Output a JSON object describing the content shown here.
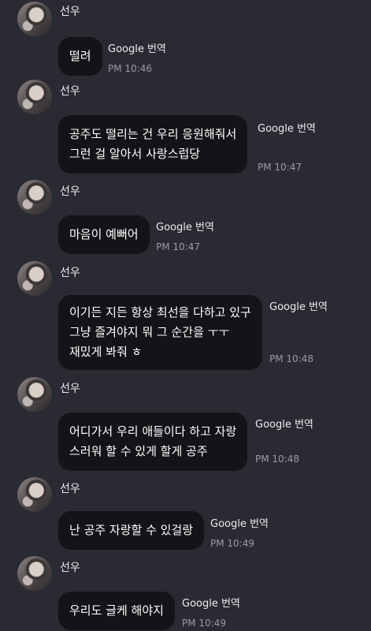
{
  "theme": {
    "background": "#2a2a33",
    "bubble": "#141418",
    "time_color": "#9b9ba4"
  },
  "messages": [
    {
      "sender": "선우",
      "text": [
        "떨려"
      ],
      "translate_label": "Google 번역",
      "time": "PM 10:46"
    },
    {
      "sender": "선우",
      "text": [
        "공주도 떨리는 건 우리 응원해줘서",
        "그런 걸 알아서 사랑스럽당"
      ],
      "translate_label": "Google 번역",
      "time": "PM 10:47"
    },
    {
      "sender": "선우",
      "text": [
        "마음이 예뻐어"
      ],
      "translate_label": "Google 번역",
      "time": "PM 10:47"
    },
    {
      "sender": "선우",
      "text": [
        "이기든 지든 항상 최선을 다하고 있구",
        " 그냥 즐겨야지 뭐 그 순간을 ㅜㅜ",
        "재밌게 봐줘 ㅎ"
      ],
      "translate_label": "Google 번역",
      "time": "PM 10:48"
    },
    {
      "sender": "선우",
      "text": [
        "어디가서 우리 애들이다 하고 자랑",
        "스러워 할 수 있게 할게 공주"
      ],
      "translate_label": "Google 번역",
      "time": "PM 10:48"
    },
    {
      "sender": "선우",
      "text": [
        "난 공주 자랑할 수 있걸랑"
      ],
      "translate_label": "Google 번역",
      "time": "PM 10:49"
    },
    {
      "sender": "선우",
      "text": [
        "우리도 글케 해야지"
      ],
      "translate_label": "Google 번역",
      "time": "PM 10:49"
    }
  ]
}
